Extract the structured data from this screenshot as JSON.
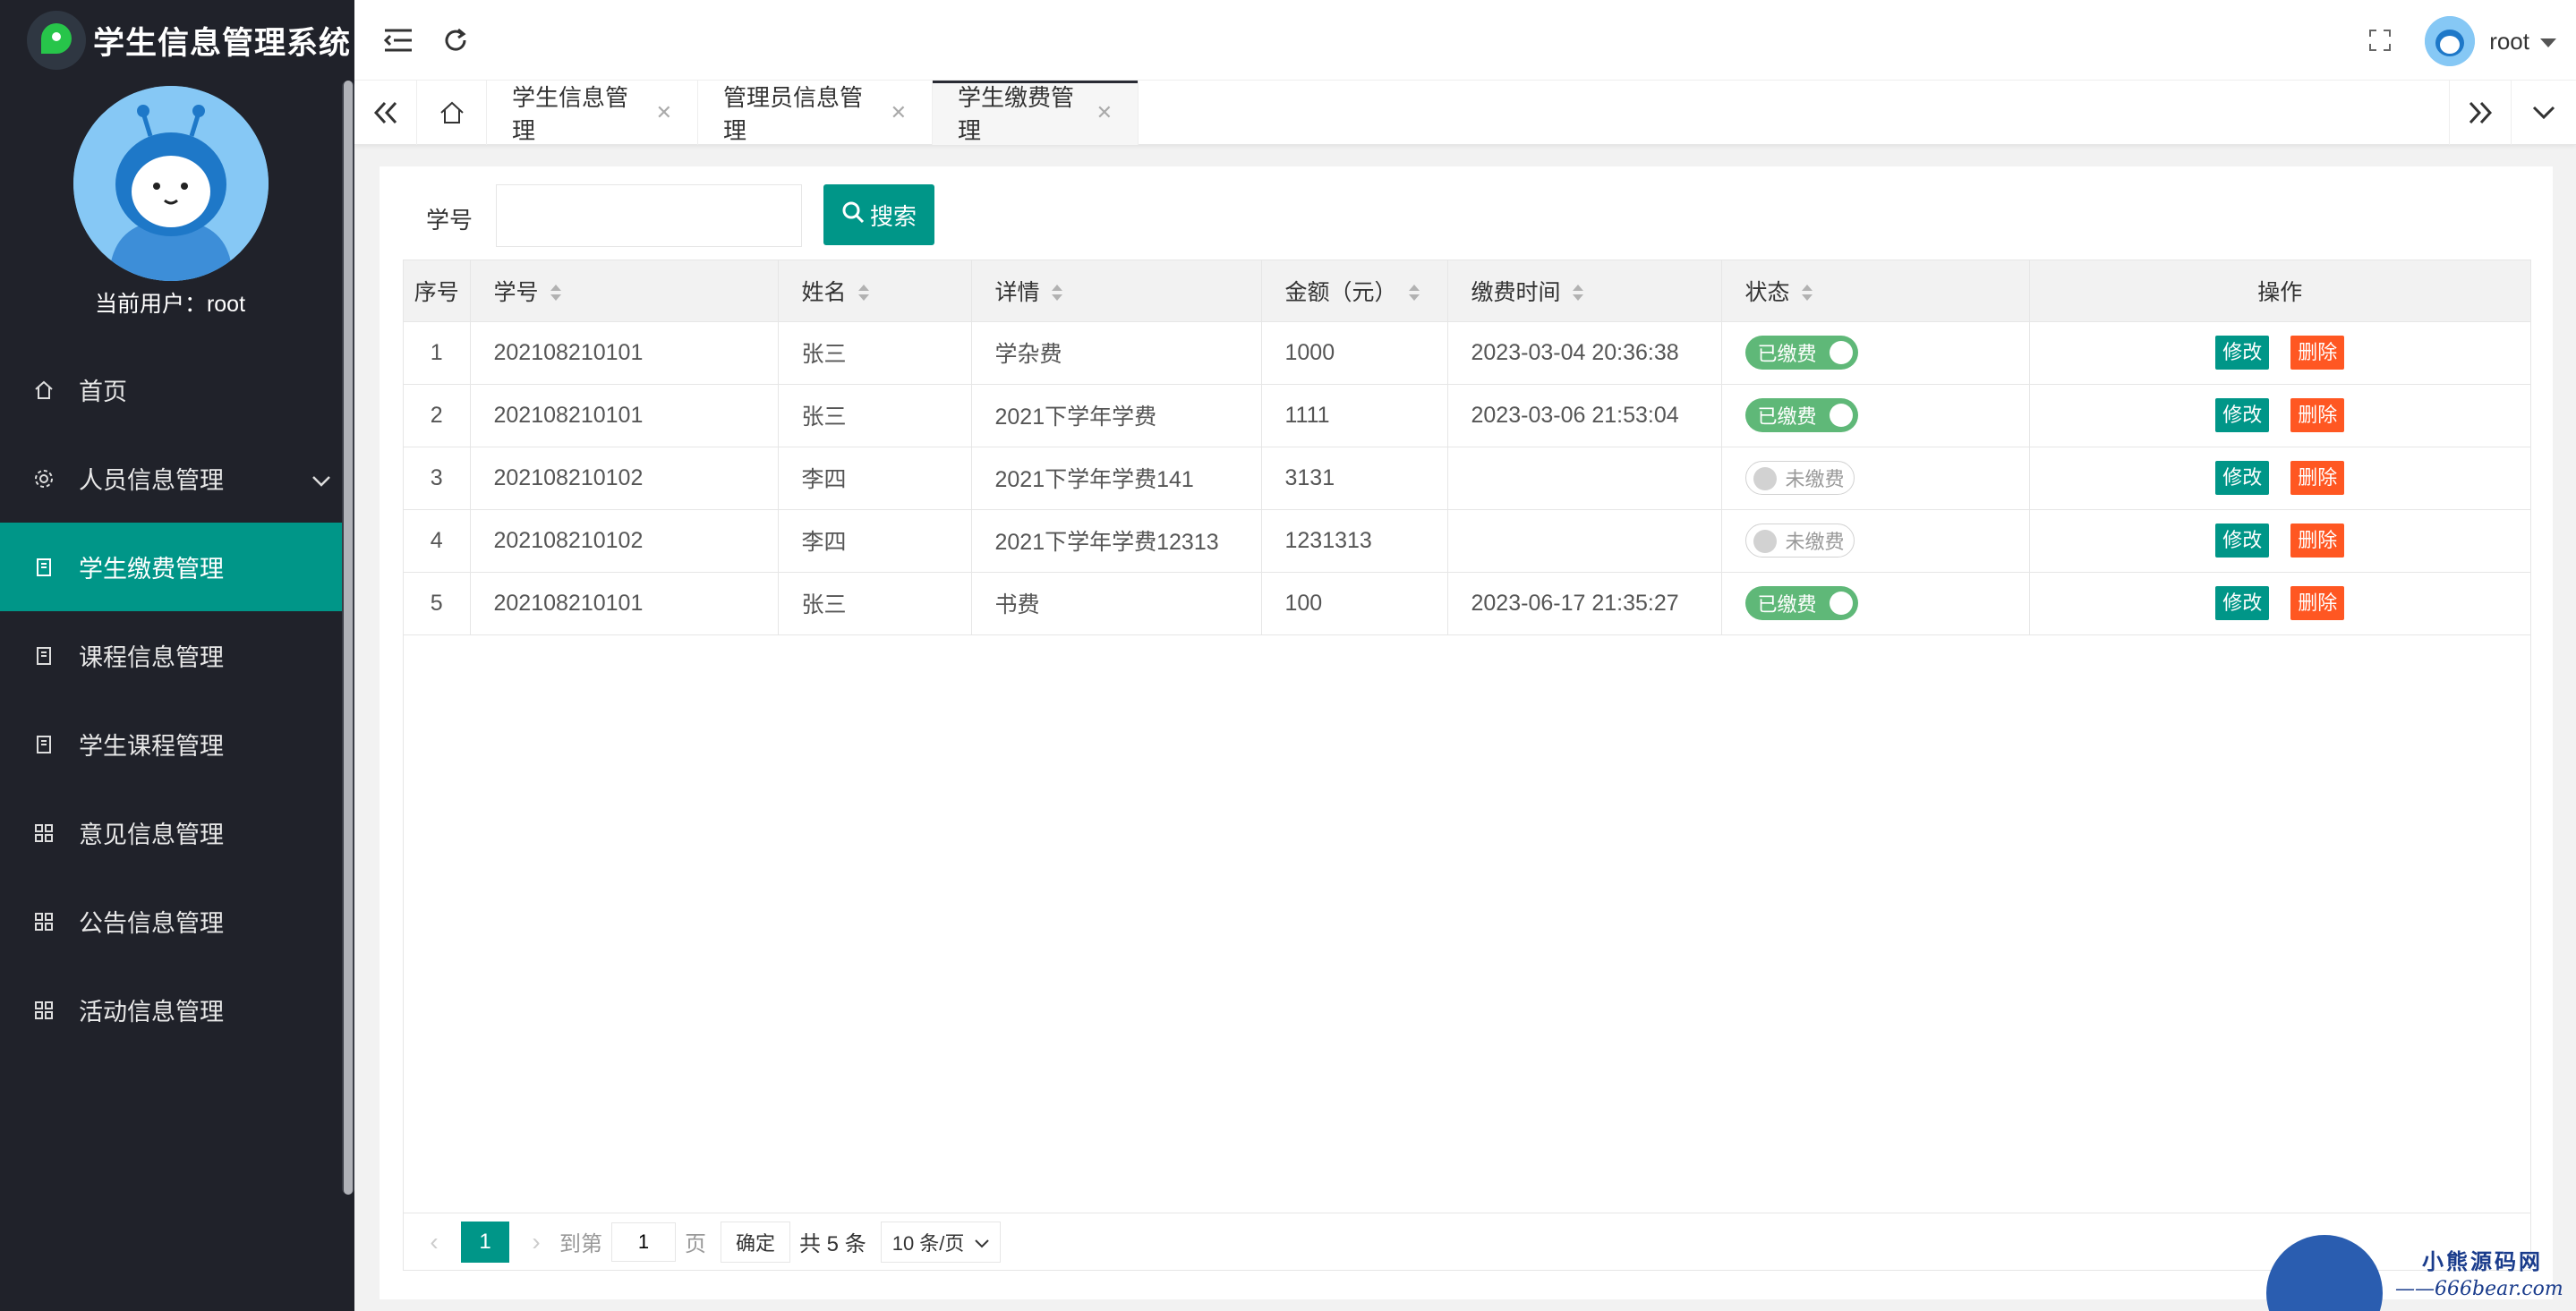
{
  "app": {
    "title": "学生信息管理系统"
  },
  "sidebar": {
    "current_user": "当前用户：root",
    "items": [
      {
        "label": "首页",
        "icon": "home-icon"
      },
      {
        "label": "人员信息管理",
        "icon": "gear-icon"
      },
      {
        "label": "学生缴费管理",
        "icon": "document-icon"
      },
      {
        "label": "课程信息管理",
        "icon": "document-icon"
      },
      {
        "label": "学生课程管理",
        "icon": "document-icon"
      },
      {
        "label": "意见信息管理",
        "icon": "app-grid-icon"
      },
      {
        "label": "公告信息管理",
        "icon": "app-grid-icon"
      },
      {
        "label": "活动信息管理",
        "icon": "app-grid-icon"
      }
    ],
    "active_index": 2
  },
  "topbar": {
    "username": "root"
  },
  "tabs": [
    {
      "label": "学生信息管理"
    },
    {
      "label": "管理员信息管理"
    },
    {
      "label": "学生缴费管理"
    }
  ],
  "search": {
    "label": "学号",
    "value": "",
    "button": "搜索"
  },
  "table": {
    "headers": [
      "序号",
      "学号",
      "姓名",
      "详情",
      "金额（元）",
      "缴费时间",
      "状态",
      "操作"
    ],
    "rows": [
      {
        "idx": "1",
        "sid": "202108210101",
        "name": "张三",
        "detail": "学杂费",
        "amount": "1000",
        "time": "2023-03-04 20:36:38",
        "status": "已缴费",
        "paid": true
      },
      {
        "idx": "2",
        "sid": "202108210101",
        "name": "张三",
        "detail": "2021下学年学费",
        "amount": "1111",
        "time": "2023-03-06 21:53:04",
        "status": "已缴费",
        "paid": true
      },
      {
        "idx": "3",
        "sid": "202108210102",
        "name": "李四",
        "detail": "2021下学年学费141",
        "amount": "3131",
        "time": "",
        "status": "未缴费",
        "paid": false
      },
      {
        "idx": "4",
        "sid": "202108210102",
        "name": "李四",
        "detail": "2021下学年学费12313",
        "amount": "1231313",
        "time": "",
        "status": "未缴费",
        "paid": false
      },
      {
        "idx": "5",
        "sid": "202108210101",
        "name": "张三",
        "detail": "书费",
        "amount": "100",
        "time": "2023-06-17 21:35:27",
        "status": "已缴费",
        "paid": true
      }
    ],
    "edit_label": "修改",
    "delete_label": "删除"
  },
  "pager": {
    "current": "1",
    "goto_label": "到第",
    "goto_value": "1",
    "page_unit": "页",
    "confirm": "确定",
    "total": "共 5 条",
    "page_size": "10 条/页"
  },
  "watermark": {
    "brand": "小熊源码网",
    "url": "——666bear.com——"
  },
  "colors": {
    "sidebar_bg": "#20222a",
    "accent": "#009688",
    "paid": "#5fb878",
    "danger": "#ff5722"
  }
}
